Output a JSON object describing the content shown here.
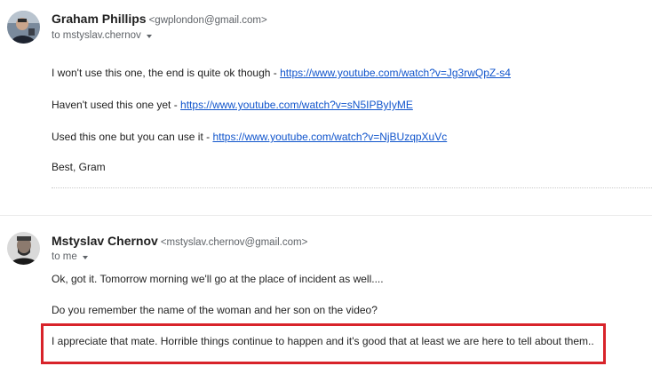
{
  "messages": [
    {
      "sender_name": "Graham Phillips",
      "sender_email": "<gwplondon@gmail.com>",
      "to_line": "to mstyslav.chernov",
      "body": [
        {
          "text": "I won't use this one, the end is quite ok though - ",
          "link": "https://www.youtube.com/watch?v=Jg3rwQpZ-s4"
        },
        {
          "text": "Haven't used this one yet - ",
          "link": "https://www.youtube.com/watch?v=sN5IPByIyME"
        },
        {
          "text": "Used this one but you can use it - ",
          "link": "https://www.youtube.com/watch?v=NjBUzqpXuVc"
        },
        {
          "text": "Best, Gram",
          "link": ""
        }
      ]
    },
    {
      "sender_name": "Mstyslav Chernov",
      "sender_email": "<mstyslav.chernov@gmail.com>",
      "to_line": "to me",
      "body": [
        {
          "text": "Ok, got it. Tomorrow morning we'll go at the place of incident as well...."
        },
        {
          "text": "Do you remember the name of the woman and her son on the video?"
        },
        {
          "text": "I appreciate that mate. Horrible things continue to happen and it's good that at least we are here to tell about them.."
        }
      ]
    }
  ],
  "highlight_color": "#d8232a",
  "link_color": "#1155cc",
  "icons": {
    "avatar1": "avatar-photo-icon",
    "avatar2": "avatar-photo-icon",
    "details_toggle": "chevron-down-icon"
  }
}
